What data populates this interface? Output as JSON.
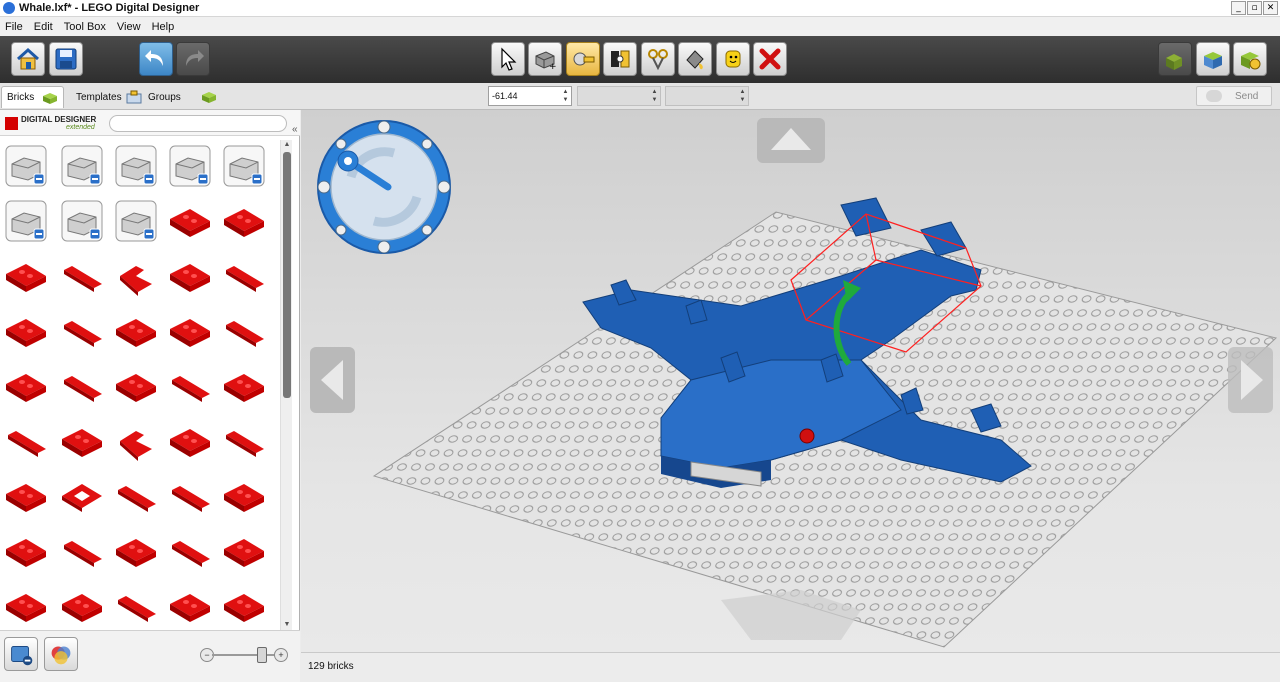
{
  "window": {
    "title": "Whale.lxf* - LEGO Digital Designer"
  },
  "window_buttons": [
    "_",
    "▫",
    "✕"
  ],
  "menu": [
    "File",
    "Edit",
    "Tool Box",
    "View",
    "Help"
  ],
  "tabs": [
    {
      "label": "Bricks",
      "icon": "brick-icon",
      "active": true
    },
    {
      "label": "Templates",
      "icon": "template-icon",
      "active": false
    },
    {
      "label": "Groups",
      "icon": "group-icon",
      "active": false
    }
  ],
  "controls": {
    "rotation_value": "-61.44",
    "send_label": "Send"
  },
  "palette": {
    "logo_line1": "DIGITAL DESIGNER",
    "logo_line2": "extended",
    "search_value": "",
    "brick_color": "#e01010",
    "brick_count": 45
  },
  "status": {
    "brick_count_label": "129 bricks"
  },
  "colors": {
    "accent_blue": "#1f5fb4",
    "brick_red": "#e01010",
    "selection_red": "#ff2020",
    "rotate_green": "#1faa3c"
  },
  "zoom": {
    "level": 0.78
  }
}
